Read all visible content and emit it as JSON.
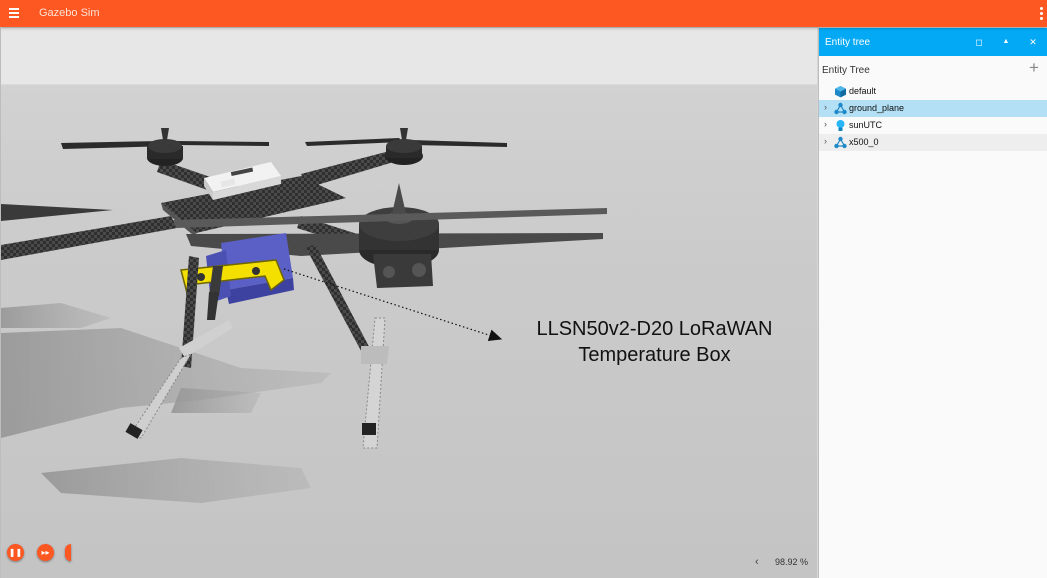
{
  "app": {
    "title": "Gazebo Sim"
  },
  "viewport": {
    "annotation": {
      "line1": "LLSN50v2-D20 LoRaWAN",
      "line2": "Temperature Box"
    },
    "controls": {
      "play_icon": "pause-icon",
      "step_icon": "fast-forward-icon"
    },
    "rtf_toggle": "‹",
    "rtf_value": "98.92 %"
  },
  "panel": {
    "title": "Entity tree",
    "buttons": [
      "restore-icon",
      "collapse-icon",
      "close-icon"
    ],
    "tree_label": "Entity Tree",
    "add_icon": "plus-icon",
    "entities": [
      {
        "name": "default",
        "icon": "world-cube-icon",
        "expandable": false
      },
      {
        "name": "ground_plane",
        "icon": "model-icon",
        "expandable": true,
        "selected": true
      },
      {
        "name": "sunUTC",
        "icon": "light-bulb-icon",
        "expandable": true
      },
      {
        "name": "x500_0",
        "icon": "model-icon",
        "expandable": true
      }
    ]
  },
  "colors": {
    "app_bar": "#fd5722",
    "panel_header": "#03a9f4",
    "selection": "#b3e0f5",
    "drone_mount": "#ffe000",
    "drone_box": "#5960c8"
  }
}
